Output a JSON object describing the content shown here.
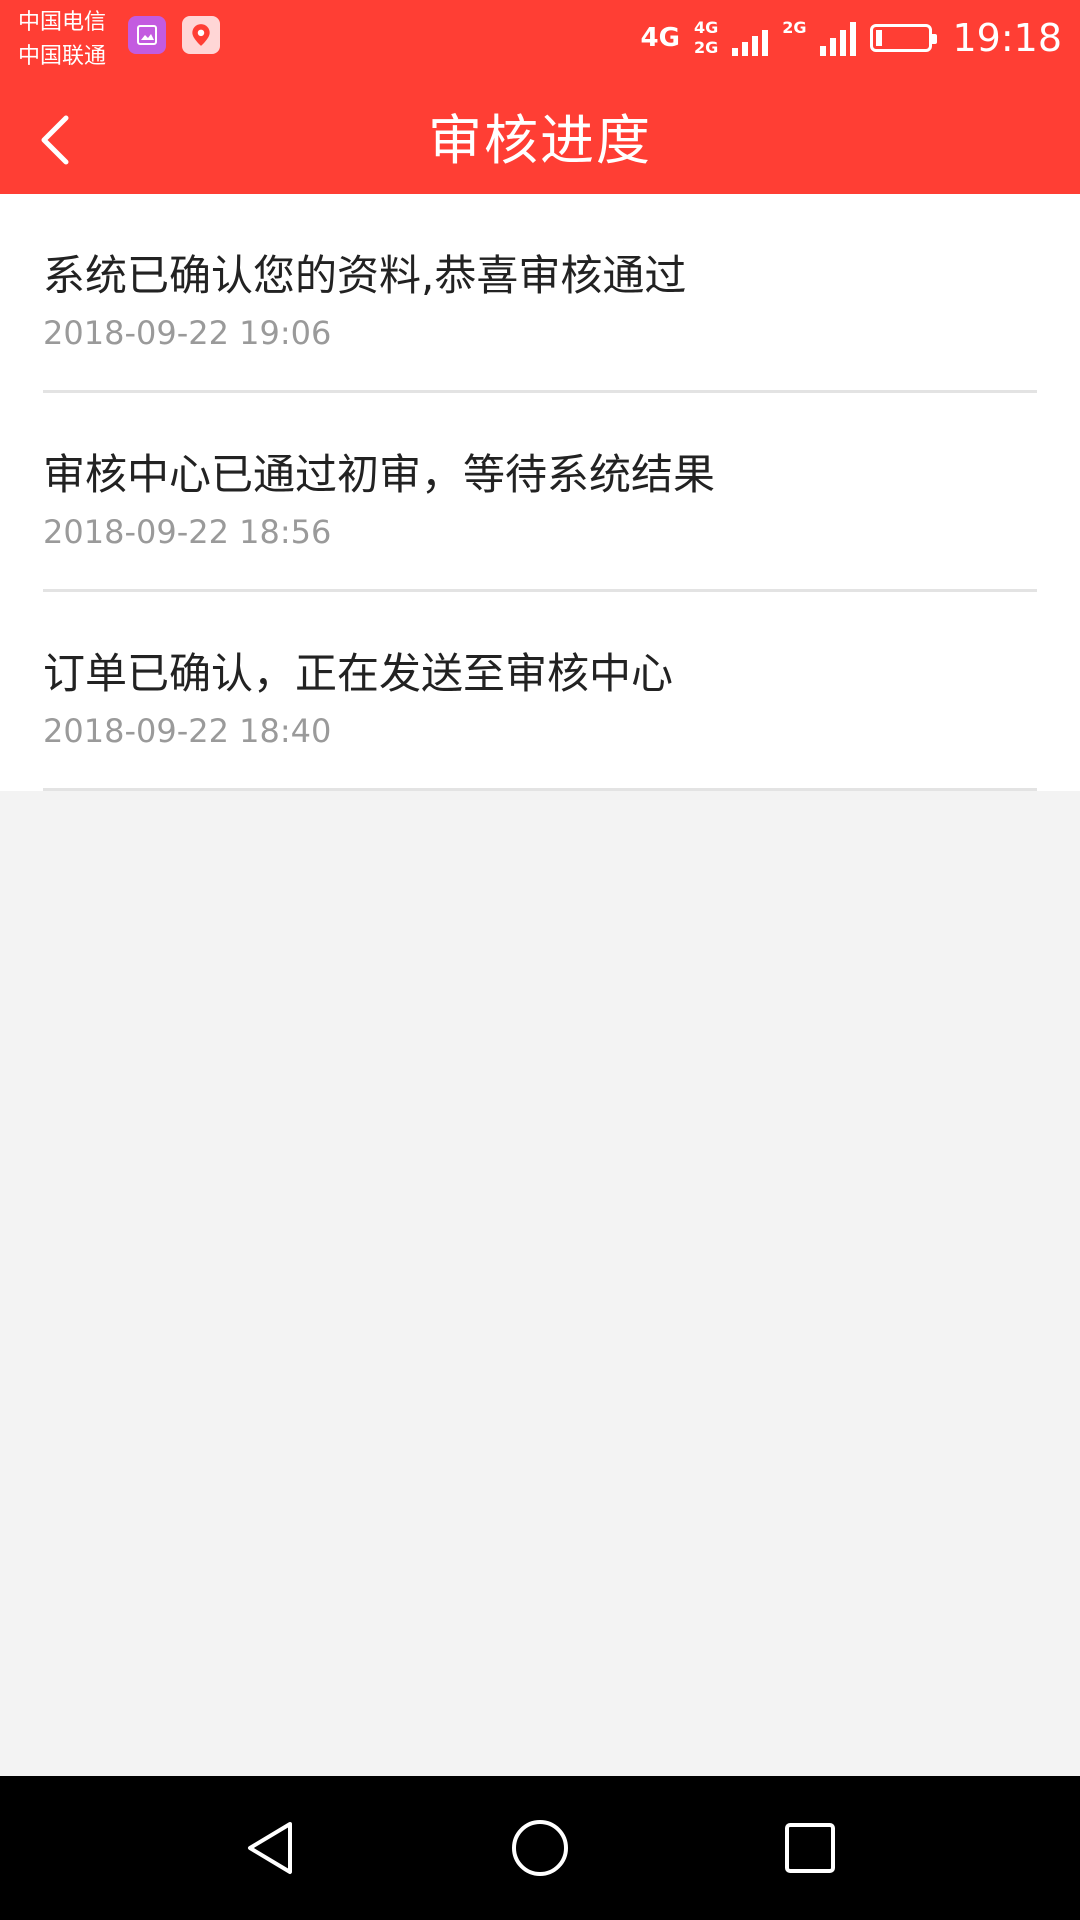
{
  "status_bar": {
    "carriers": [
      "中国电信",
      "中国联通"
    ],
    "net_primary": "4G",
    "net_secondary_top": "4G",
    "net_secondary_bottom": "2G",
    "net_tertiary": "2G",
    "battery_level": 0.1,
    "time": "19:18"
  },
  "header": {
    "title": "审核进度",
    "back_icon": "chevron-left-icon"
  },
  "progress": [
    {
      "title": "系统已确认您的资料,恭喜审核通过",
      "time": "2018-09-22 19:06"
    },
    {
      "title": "审核中心已通过初审，等待系统结果",
      "time": "2018-09-22 18:56"
    },
    {
      "title": "订单已确认，正在发送至审核中心",
      "time": "2018-09-22 18:40"
    }
  ],
  "colors": {
    "accent": "#ff3e34",
    "title_text": "#222222",
    "time_text": "#9a9a9a",
    "divider": "#e3e3e3",
    "background": "#f3f3f3"
  },
  "nav_bar": {
    "back": "triangle-back-icon",
    "home": "circle-home-icon",
    "recents": "square-recents-icon"
  }
}
